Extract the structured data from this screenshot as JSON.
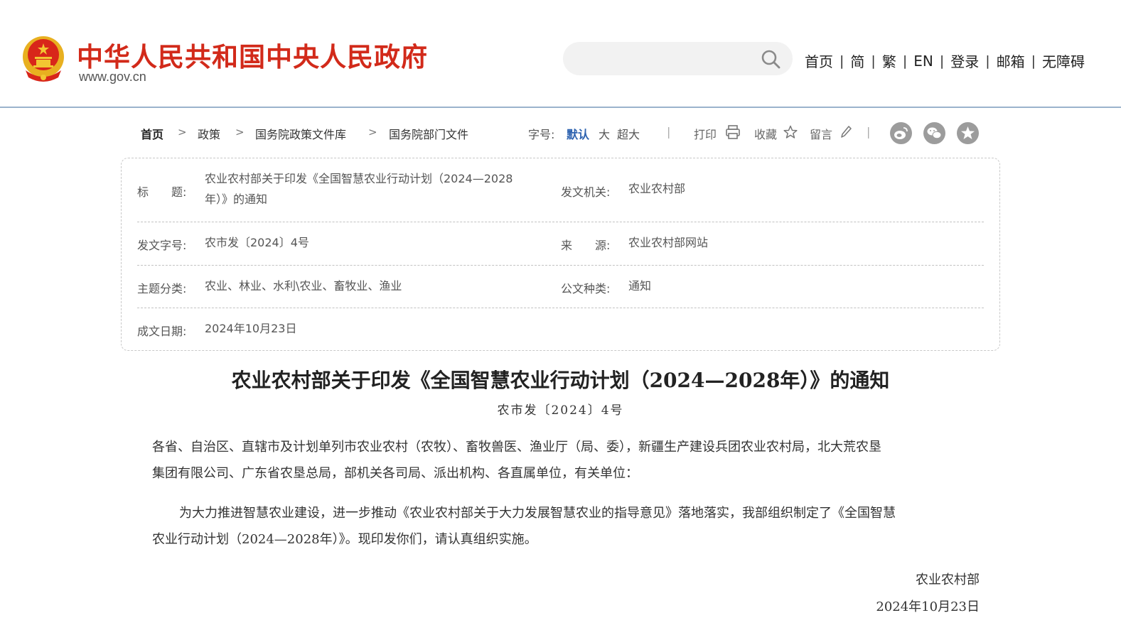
{
  "header": {
    "site_title": "中华人民共和国中央人民政府",
    "site_url": "www.gov.cn",
    "search_placeholder": "",
    "nav": [
      "首页",
      "简",
      "繁",
      "EN",
      "登录",
      "邮箱",
      "无障碍"
    ],
    "brand_color": "#d22a1a"
  },
  "breadcrumb": [
    "首页",
    "政策",
    "国务院政策文件库",
    "国务院部门文件"
  ],
  "toolbar": {
    "font_size_label": "字号:",
    "font_sizes": [
      "默认",
      "大",
      "超大"
    ],
    "active_font_size": "默认",
    "print_label": "打印",
    "favorite_label": "收藏",
    "comment_label": "留言",
    "share_icons": [
      "weibo-icon",
      "wechat-icon",
      "qzone-icon"
    ]
  },
  "info": {
    "title_label": "标　　题:",
    "title_value_line1": "农业农村部关于印发《全国智慧农业行动计划（2024—2028",
    "title_value_line2": "年）》的通知",
    "issuer_label": "发文机关:",
    "issuer_value": "农业农村部",
    "doc_no_label": "发文字号:",
    "doc_no_value": "农市发〔2024〕4号",
    "source_label": "来　　源:",
    "source_value": "农业农村部网站",
    "category_label": "主题分类:",
    "category_value": "农业、林业、水利\\农业、畜牧业、渔业",
    "doc_type_label": "公文种类:",
    "doc_type_value": "通知",
    "date_label": "成文日期:",
    "date_value": "2024年10月23日"
  },
  "article": {
    "title": "农业农村部关于印发《全国智慧农业行动计划（2024—2028年）》的通知",
    "doc_no": "农市发〔2024〕4号",
    "addressee_line1": "各省、自治区、直辖市及计划单列市农业农村（农牧）、畜牧兽医、渔业厅（局、委），新疆生产建设兵团农业农村局，北大荒农垦",
    "addressee_line2": "集团有限公司、广东省农垦总局，部机关各司局、派出机构、各直属单位，有关单位：",
    "body_line1": "为大力推进智慧农业建设，进一步推动《农业农村部关于大力发展智慧农业的指导意见》落地落实，我部组织制定了《全国智慧",
    "body_line2": "农业行动计划（2024—2028年）》。现印发你们，请认真组织实施。",
    "signature": "农业农村部",
    "sign_date": "2024年10月23日"
  }
}
